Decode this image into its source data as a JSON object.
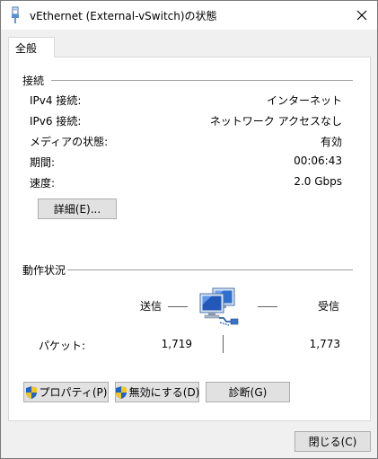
{
  "window": {
    "title": "vEthernet (External-vSwitch)の状態",
    "icon": "network-adapter-icon",
    "close_icon": "close-icon"
  },
  "tabs": [
    {
      "label": "全般",
      "selected": true
    }
  ],
  "connection": {
    "heading": "接続",
    "rows": [
      {
        "label": "IPv4 接続:",
        "value": "インターネット"
      },
      {
        "label": "IPv6 接続:",
        "value": "ネットワーク アクセスなし"
      },
      {
        "label": "メディアの状態:",
        "value": "有効"
      },
      {
        "label": "期間:",
        "value": "00:06:43"
      },
      {
        "label": "速度:",
        "value": "2.0 Gbps"
      }
    ],
    "details_button": "詳細(E)..."
  },
  "activity": {
    "heading": "動作状況",
    "sent_label": "送信",
    "received_label": "受信",
    "packets_label": "パケット:",
    "packets_sent": "1,719",
    "packets_received": "1,773",
    "icon": "network-computers-icon"
  },
  "actions": {
    "properties": "プロパティ(P)",
    "disable": "無効にする(D)",
    "diagnose": "診断(G)",
    "shield_icon": "uac-shield-icon"
  },
  "footer": {
    "close": "閉じる(C)"
  },
  "colors": {
    "titlebar": "#ffffff",
    "face": "#f0f0f0",
    "button": "#e1e1e1",
    "shield_blue": "#1f64c8",
    "shield_yellow": "#f5c518"
  }
}
